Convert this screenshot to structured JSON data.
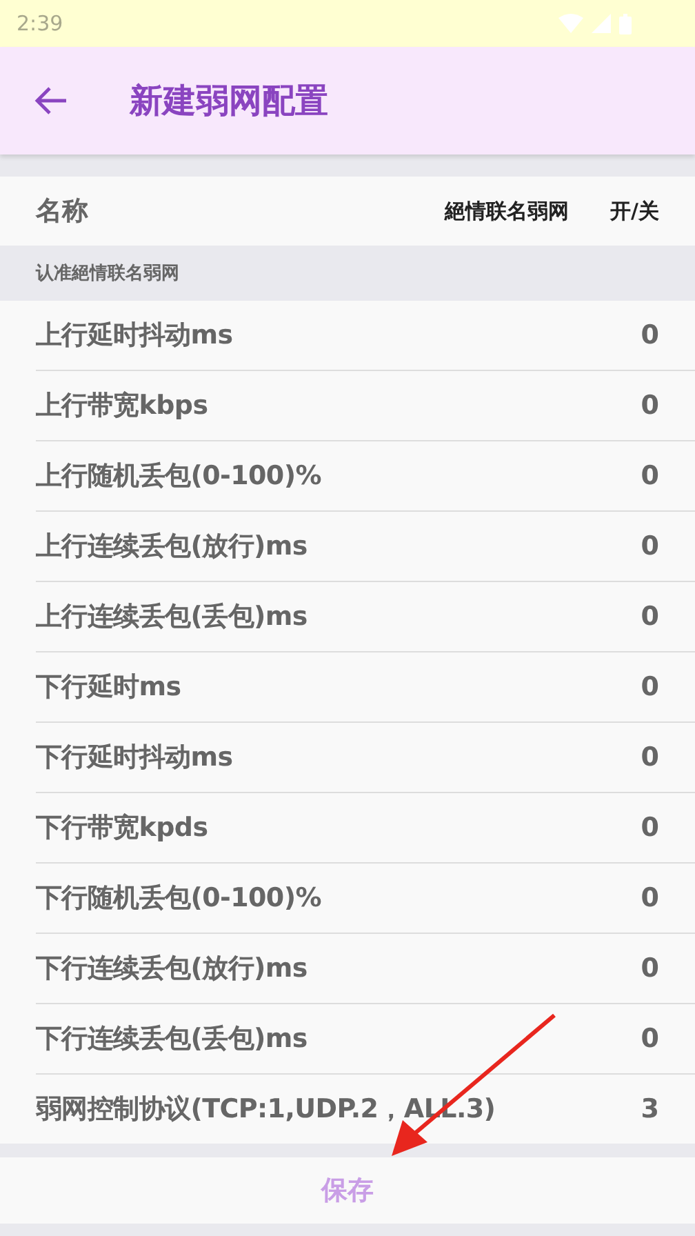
{
  "status_bar": {
    "time": "2:39"
  },
  "app_bar": {
    "title": "新建弱网配置"
  },
  "header": {
    "name": "名称",
    "profile": "絕情联名弱网",
    "toggle": "开/关"
  },
  "section": {
    "title": "认准絕情联名弱网"
  },
  "rows": [
    {
      "label": "上行延时抖动ms",
      "value": "0"
    },
    {
      "label": "上行带宽kbps",
      "value": "0"
    },
    {
      "label": "上行随机丢包(0-100)%",
      "value": "0"
    },
    {
      "label": "上行连续丢包(放行)ms",
      "value": "0"
    },
    {
      "label": "上行连续丢包(丢包)ms",
      "value": "0"
    },
    {
      "label": "下行延时ms",
      "value": "0"
    },
    {
      "label": "下行延时抖动ms",
      "value": "0"
    },
    {
      "label": "下行带宽kpds",
      "value": "0"
    },
    {
      "label": "下行随机丢包(0-100)%",
      "value": "0"
    },
    {
      "label": "下行连续丢包(放行)ms",
      "value": "0"
    },
    {
      "label": "下行连续丢包(丢包)ms",
      "value": "0"
    },
    {
      "label": "弱网控制协议(TCP:1,UDP.2，ALL.3)",
      "value": "3"
    }
  ],
  "save_button": {
    "label": "保存",
    "disabled": true
  }
}
